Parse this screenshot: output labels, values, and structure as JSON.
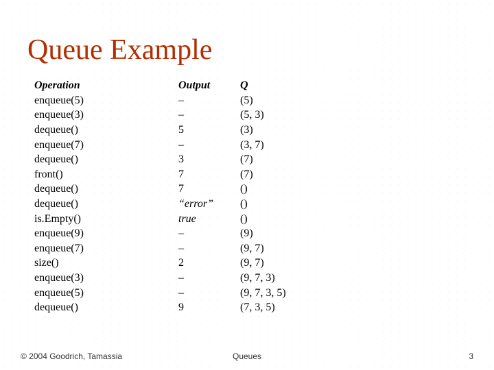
{
  "title": "Queue Example",
  "headers": {
    "op": "Operation",
    "out": "Output",
    "q": "Q"
  },
  "rows": [
    {
      "op": "enqueue(5)",
      "out": "–",
      "q": "(5)"
    },
    {
      "op": "enqueue(3)",
      "out": "–",
      "q": "(5, 3)"
    },
    {
      "op": "dequeue()",
      "out": "5",
      "q": "(3)"
    },
    {
      "op": "enqueue(7)",
      "out": "–",
      "q": "(3, 7)"
    },
    {
      "op": "dequeue()",
      "out": "3",
      "q": "(7)"
    },
    {
      "op": "front()",
      "out": "7",
      "q": "(7)"
    },
    {
      "op": "dequeue()",
      "out": "7",
      "q": "()"
    },
    {
      "op": "dequeue()",
      "out": "“error”",
      "q": "()"
    },
    {
      "op": "is.Empty()",
      "out": "true",
      "q": "()"
    },
    {
      "op": "enqueue(9)",
      "out": "–",
      "q": "(9)"
    },
    {
      "op": "enqueue(7)",
      "out": "–",
      "q": "(9, 7)"
    },
    {
      "op": "size()",
      "out": "2",
      "q": "(9, 7)"
    },
    {
      "op": "enqueue(3)",
      "out": "–",
      "q": "(9, 7, 3)"
    },
    {
      "op": "enqueue(5)",
      "out": "–",
      "q": "(9, 7, 3, 5)"
    },
    {
      "op": "dequeue()",
      "out": "9",
      "q": "(7, 3, 5)"
    }
  ],
  "footer": {
    "left": "© 2004 Goodrich, Tamassia",
    "center": "Queues",
    "right": "3"
  }
}
